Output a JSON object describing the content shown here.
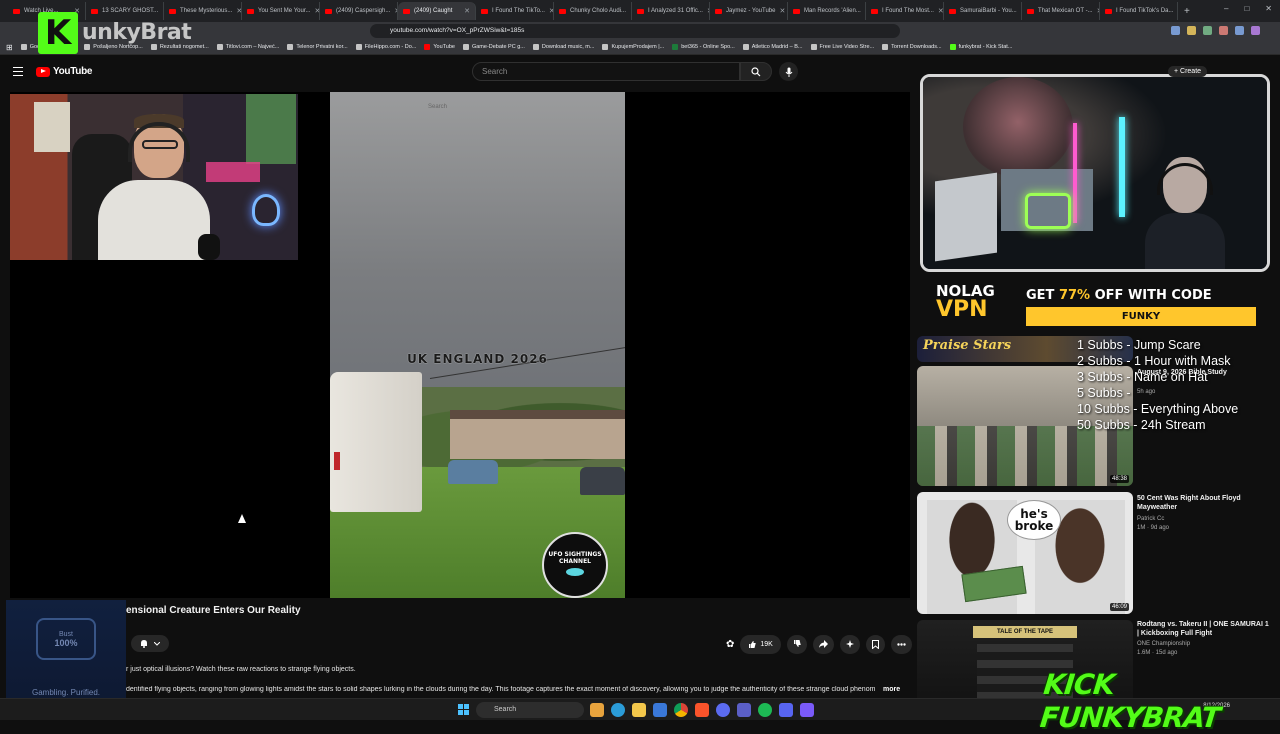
{
  "browser": {
    "tabs": [
      {
        "label": "Watch Live..."
      },
      {
        "label": "13 SCARY GHOST..."
      },
      {
        "label": "These Mysterious..."
      },
      {
        "label": "You Sent Me Your..."
      },
      {
        "label": "(2409) Caspersigh..."
      },
      {
        "label": "(2409) Caught",
        "active": true
      },
      {
        "label": "I Found The TikTo..."
      },
      {
        "label": "Chunky Cholo Audi..."
      },
      {
        "label": "I Analyzed 31 Offic..."
      },
      {
        "label": "Jaymez - YouTube"
      },
      {
        "label": "Man Records 'Alien..."
      },
      {
        "label": "I Found The Most..."
      },
      {
        "label": "SamuraiBarbi - You..."
      },
      {
        "label": "That Mexican OT -..."
      },
      {
        "label": "I Found TikTok's Da..."
      }
    ],
    "new_tab": "+",
    "window_controls": [
      "–",
      "□",
      "✕"
    ],
    "url": "youtube.com/watch?v=OX_pPrZWSiw&t=185s",
    "bookmarks": [
      "Google прогресс...",
      "Pošaljeno Nortčop...",
      "Rezultati nogomet...",
      "Titlovi.com – Najveć...",
      "Telenor Privatni kor...",
      "FileHippo.com - Do...",
      "YouTube",
      "Game-Debate PC g...",
      "Download music, m...",
      "KupujemProdajem |...",
      "bet365 - Online Spo...",
      "Atletico Madrid – B...",
      "Free Live Video Stre...",
      "Torrent Downloads...",
      "funkybrat - Kick Stat..."
    ]
  },
  "kick_overlay": {
    "logo_letter": "K",
    "name": "unkyBrat",
    "bottom_banner": "KICK FUNKYBRAT"
  },
  "youtube": {
    "logo_text": "YouTube",
    "search_placeholder": "Search",
    "create_label": "+ Create"
  },
  "video": {
    "inner_search": "Search",
    "overlay_caption": "UK ENGLAND 2026",
    "channel_badge": "UFO SIGHTINGS CHANNEL",
    "title": "ensional Creature Enters Our Reality",
    "like_count": "19K",
    "description_line1": "r just optical illusions? Watch these raw reactions to strange flying objects.",
    "description_line2": "dentified flying objects, ranging from glowing lights amidst the stars to solid shapes lurking in the clouds during the day. This footage captures the exact moment of discovery, allowing you to judge the authenticity of these strange cloud phenom",
    "more_label": "more"
  },
  "gamble_ad": {
    "brand": "Bust",
    "pct": "100%",
    "tagline": "Gambling. Purified."
  },
  "vpn_ad": {
    "logo_top": "NOLAG",
    "logo_bottom": "VPN",
    "offer_prefix": "GET ",
    "offer_pct": "77%",
    "offer_suffix": " OFF WITH CODE",
    "code": "FUNKY"
  },
  "sub_goals": [
    "1 Subbs - Jump Scare",
    "2 Subbs - 1 Hour with Mask",
    "3 Subbs - Name on Hat",
    "5 Subbs -",
    "10 Subbs - Everything Above",
    "50 Subbs - 24h Stream"
  ],
  "recommendations": [
    {
      "thumb_text": "Praise Stars"
    },
    {
      "duration": "48:38",
      "title": "August 9, 2026 Bible Study",
      "meta": "5h ago"
    },
    {
      "duration": "46:09",
      "title": "50 Cent Was Right About Floyd Mayweather",
      "channel": "Patrick Cc",
      "meta": "1M · 9d ago",
      "bubble": "he's broke"
    },
    {
      "bar": "TALE OF THE TAPE",
      "title": "Rodtang vs. Takeru II | ONE SAMURAI 1 | Kickboxing Full Fight",
      "channel": "ONE Championship",
      "meta": "1.6M · 15d ago"
    }
  ],
  "taskbar": {
    "search_label": "Search",
    "date": "8/12/2026"
  },
  "colors": {
    "kick_green": "#53fc18",
    "youtube_red": "#ff0000",
    "vpn_yellow": "#ffc62c"
  }
}
